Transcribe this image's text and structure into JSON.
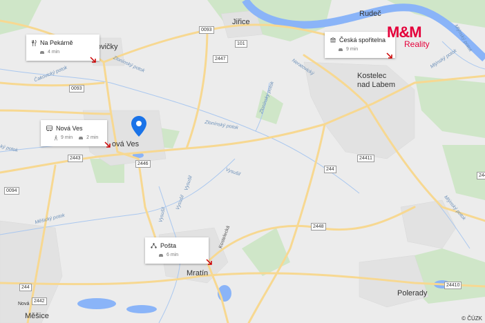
{
  "map": {
    "pois": [
      {
        "icon": "restaurant-icon",
        "name": "Na Pekárně",
        "times": [
          {
            "icon": "car-icon",
            "text": "4 min"
          }
        ]
      },
      {
        "icon": "bank-icon",
        "name": "Česká spořitelna",
        "times": [
          {
            "icon": "car-icon",
            "text": "9 min"
          }
        ]
      },
      {
        "icon": "bus-icon",
        "name": "Nová Ves",
        "times": [
          {
            "icon": "walk-icon",
            "text": "9 min"
          },
          {
            "icon": "car-icon",
            "text": "2 min"
          }
        ]
      },
      {
        "icon": "post-office-icon",
        "name": "Pošta",
        "times": [
          {
            "icon": "car-icon",
            "text": "6 min"
          }
        ]
      }
    ],
    "towns": {
      "jirice": "Jiřice",
      "rudec": "Rudeč",
      "kostelec": [
        "Kostelec",
        "nad Labem"
      ],
      "novaves": "ová Ves",
      "rovicky": "ovičky",
      "mratin": "Mratín",
      "polerady": "Polerady",
      "mesice": "Měšice",
      "nova": "Nová"
    },
    "streams": {
      "zlonin1": "Zlonínský potok",
      "zlonin2": "Zlonínský potok",
      "zlonin3": "Zlonínský potok",
      "cakovicky": "Čakovický potok",
      "nerat": "Neratovický",
      "mesicky": "Měšický potok",
      "mlynsky": "Mlýnský potok",
      "mlynsky2": "Mlýnský potok",
      "vysusil1": "Vysušil",
      "vysusil2": "Vysušil",
      "vysusil3": "Vysušil",
      "vysusil4": "Vysušil",
      "left": "ký potok",
      "mlynsky3": "Mlýnský potok"
    },
    "roads": {
      "r0093a": "0093",
      "r0093b": "0093",
      "r101": "101",
      "r2447": "2447",
      "r2443": "2443",
      "r2446": "2446",
      "r0094": "0094",
      "r244a": "244",
      "r244b": "244",
      "r24411": "24411",
      "r2448": "2448",
      "r24410": "24410",
      "r2442": "2442",
      "r244c": "244",
      "kostelecka": "Kostelecká"
    },
    "logo": {
      "brand": "M&M",
      "sub": "Reality",
      "color": "#e4003a"
    },
    "copyright": "© ČÚZK",
    "colors": {
      "river": "#8ab4f8",
      "land": "#ececec",
      "green": "#cfe6c8",
      "road": "#f7d891",
      "pin": "#1a73e8"
    }
  }
}
